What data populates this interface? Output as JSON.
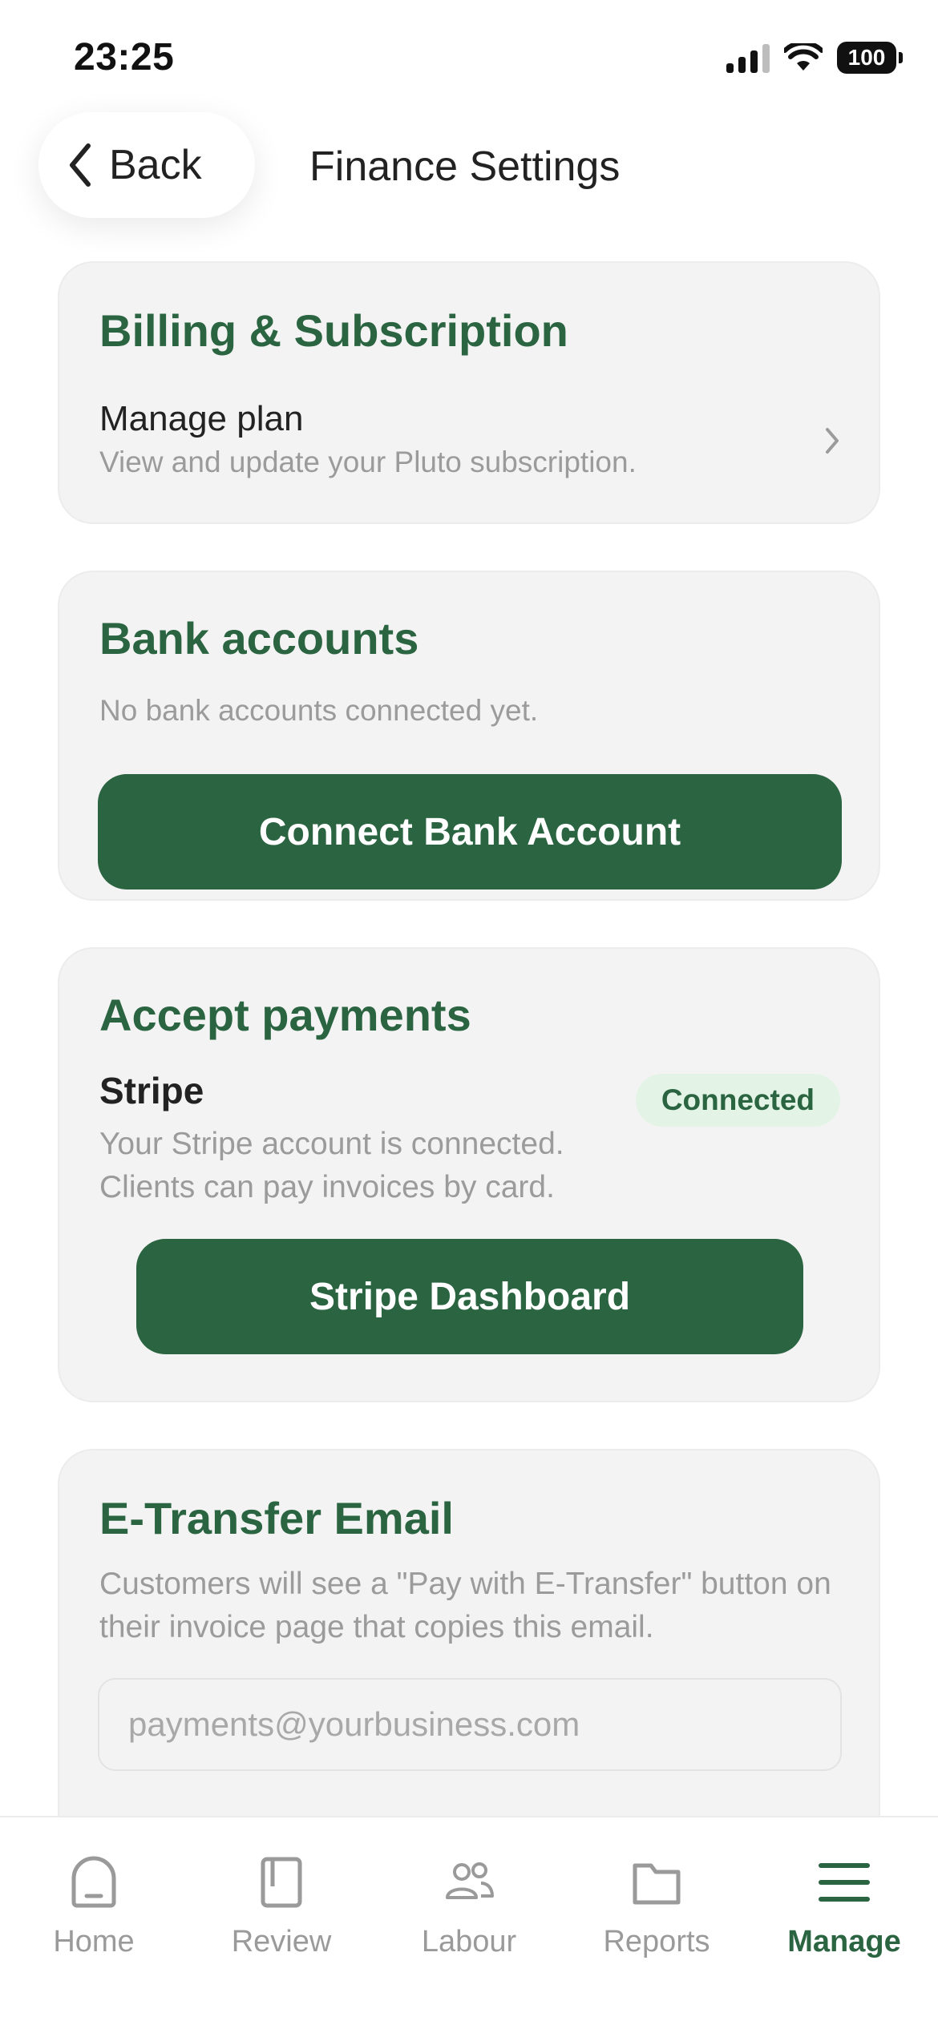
{
  "status_bar": {
    "time": "23:25",
    "battery": "100",
    "icons": [
      "signal-icon",
      "wifi-icon",
      "battery-icon"
    ]
  },
  "header": {
    "back_label": "Back",
    "title": "Finance Settings"
  },
  "billing": {
    "title": "Billing & Subscription",
    "manage_plan_title": "Manage plan",
    "manage_plan_subtitle": "View and update your Pluto subscription."
  },
  "bank": {
    "title": "Bank accounts",
    "empty_text": "No bank accounts connected yet.",
    "connect_button": "Connect Bank Account"
  },
  "payments": {
    "title": "Accept payments",
    "provider": "Stripe",
    "status_badge": "Connected",
    "desc_line1": "Your Stripe account is connected.",
    "desc_line2": "Clients can pay invoices by card.",
    "dashboard_button": "Stripe Dashboard"
  },
  "etransfer": {
    "title": "E-Transfer Email",
    "description": "Customers will see a \"Pay with E-Transfer\" button on their invoice page that copies this email.",
    "email_value": "",
    "email_placeholder": "payments@yourbusiness.com"
  },
  "tab_bar": {
    "active": "Manage",
    "tabs": [
      {
        "label": "Home",
        "icon": "home-icon"
      },
      {
        "label": "Review",
        "icon": "document-icon"
      },
      {
        "label": "Labour",
        "icon": "people-icon"
      },
      {
        "label": "Reports",
        "icon": "folder-icon"
      },
      {
        "label": "Manage",
        "icon": "menu-icon"
      }
    ]
  },
  "colors": {
    "accent": "#2a6441",
    "card_bg": "#f3f3f3",
    "badge_bg": "#e3f4e6",
    "muted_text": "#9b9b9b",
    "inactive_tab": "#9a9a9a"
  }
}
